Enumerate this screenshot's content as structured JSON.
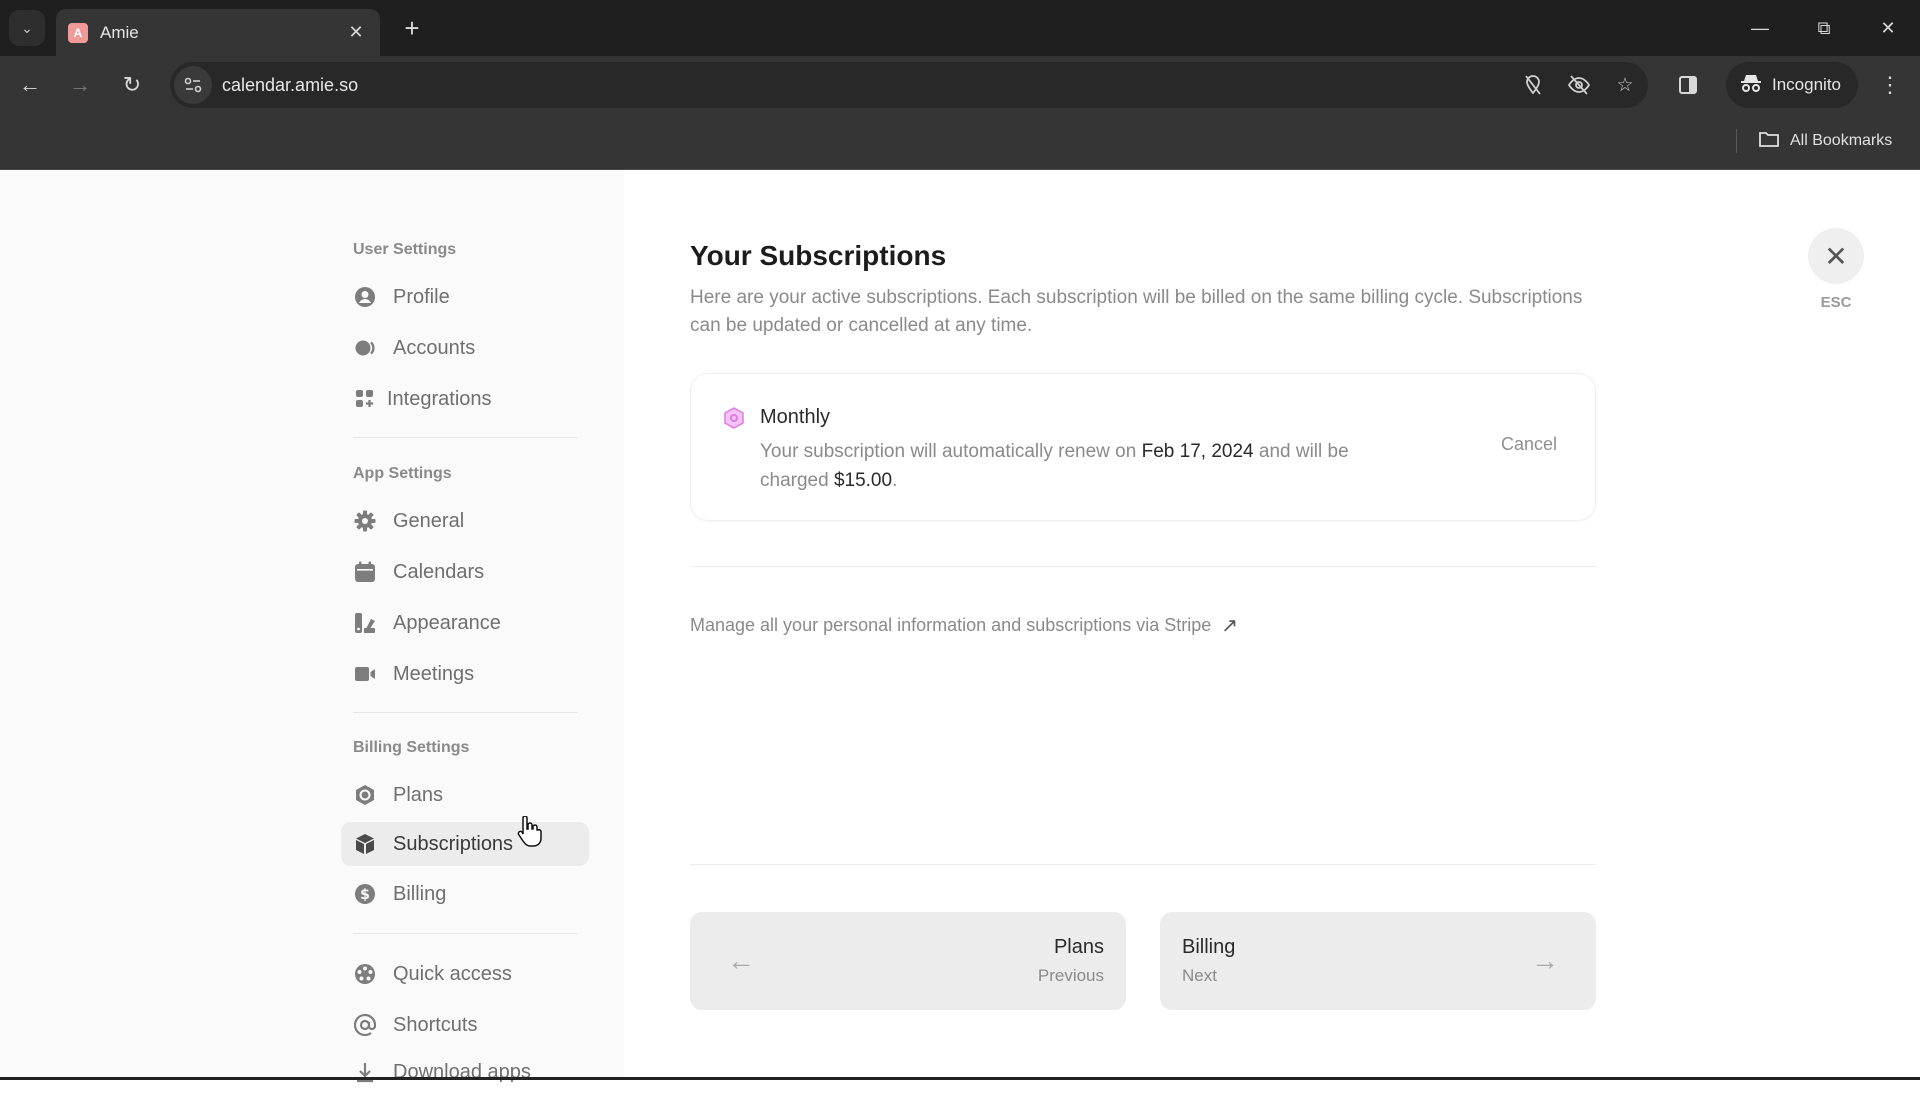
{
  "browser": {
    "tab": {
      "title": "Amie",
      "favicon_letter": "A"
    },
    "url": "calendar.amie.so",
    "incognito_label": "Incognito",
    "bookmarks_label": "All Bookmarks"
  },
  "sidebar": {
    "sections": [
      {
        "title": "User Settings",
        "items": [
          {
            "label": "Profile",
            "icon": "user-circle-icon"
          },
          {
            "label": "Accounts",
            "icon": "accounts-icon"
          },
          {
            "label": "Integrations",
            "icon": "grid-plus-icon"
          }
        ]
      },
      {
        "title": "App Settings",
        "items": [
          {
            "label": "General",
            "icon": "gear-icon"
          },
          {
            "label": "Calendars",
            "icon": "calendar-icon"
          },
          {
            "label": "Appearance",
            "icon": "appearance-icon"
          },
          {
            "label": "Meetings",
            "icon": "video-icon"
          }
        ]
      },
      {
        "title": "Billing Settings",
        "items": [
          {
            "label": "Plans",
            "icon": "hexagon-icon"
          },
          {
            "label": "Subscriptions",
            "icon": "box-icon",
            "active": true
          },
          {
            "label": "Billing",
            "icon": "dollar-icon"
          }
        ]
      },
      {
        "title": "",
        "items": [
          {
            "label": "Quick access",
            "icon": "aperture-icon"
          },
          {
            "label": "Shortcuts",
            "icon": "at-icon"
          },
          {
            "label": "Download apps",
            "icon": "download-icon"
          }
        ]
      }
    ]
  },
  "main": {
    "title": "Your Subscriptions",
    "subtitle": "Here are your active subscriptions. Each subscription will be billed on the same billing cycle. Subscriptions can be updated or cancelled at any time.",
    "subscription": {
      "plan": "Monthly",
      "desc_before": "Your subscription will automatically renew on ",
      "renew_date": "Feb 17, 2024",
      "desc_middle": " and will be charged ",
      "amount": "$15.00",
      "desc_after": ".",
      "cancel_label": "Cancel",
      "accent_color": "#e27ae6"
    },
    "stripe_link": "Manage all your personal information and subscriptions via Stripe",
    "prev": {
      "title": "Plans",
      "sub": "Previous"
    },
    "next": {
      "title": "Billing",
      "sub": "Next"
    }
  },
  "close": {
    "label": "ESC"
  }
}
